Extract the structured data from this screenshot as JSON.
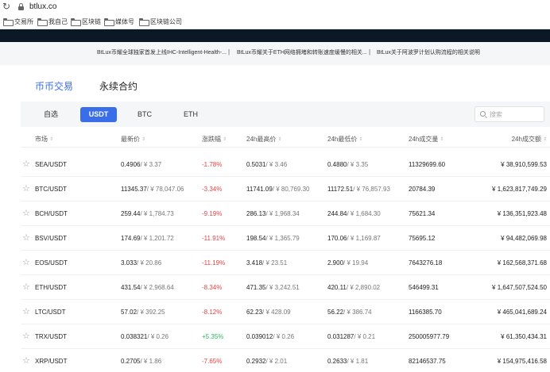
{
  "browser": {
    "url": "btlux.co"
  },
  "bookmarks": [
    {
      "label": "交易所"
    },
    {
      "label": "我自己"
    },
    {
      "label": "区块链"
    },
    {
      "label": "媒体号"
    },
    {
      "label": "区块链公司"
    }
  ],
  "notices": [
    "BtLux币耀全球独家首发上线IHC-Intelligent-Health-...",
    "BtLux币耀关于ETH网络拥堵和转账速度缓慢的相关...",
    "BtLux关于阿波罗计划认购流程的相关说明"
  ],
  "notice_separator": "|",
  "main_tabs": [
    {
      "label": "币币交易",
      "active": true
    },
    {
      "label": "永续合约",
      "active": false
    }
  ],
  "filter_tabs": [
    {
      "label": "自选",
      "active": false
    },
    {
      "label": "USDT",
      "active": true
    },
    {
      "label": "BTC",
      "active": false
    },
    {
      "label": "ETH",
      "active": false
    }
  ],
  "search": {
    "placeholder": "搜索"
  },
  "table": {
    "columns": [
      "市场",
      "最新价",
      "涨跌幅",
      "24h最高价",
      "24h最低价",
      "24h成交量",
      "24h成交额"
    ],
    "rows": [
      {
        "market": "SEA/USDT",
        "last": "0.4906",
        "last_cny": "/ ¥ 3.37",
        "change": "-1.78%",
        "high": "0.5031",
        "high_cny": "/ ¥ 3.46",
        "low": "0.4880",
        "low_cny": "/ ¥ 3.35",
        "volume": "11329699.60",
        "amount": "¥ 38,910,599.53"
      },
      {
        "market": "BTC/USDT",
        "last": "11345.37",
        "last_cny": "/ ¥ 78,047.06",
        "change": "-3.34%",
        "high": "11741.09",
        "high_cny": "/ ¥ 80,769.30",
        "low": "11172.51",
        "low_cny": "/ ¥ 76,857.93",
        "volume": "20784.39",
        "amount": "¥ 1,623,817,749.29"
      },
      {
        "market": "BCH/USDT",
        "last": "259.44",
        "last_cny": "/ ¥ 1,784.73",
        "change": "-9.19%",
        "high": "286.13",
        "high_cny": "/ ¥ 1,968.34",
        "low": "244.84",
        "low_cny": "/ ¥ 1,684.30",
        "volume": "75621.34",
        "amount": "¥ 136,351,923.48"
      },
      {
        "market": "BSV/USDT",
        "last": "174.69",
        "last_cny": "/ ¥ 1,201.72",
        "change": "-11.91%",
        "high": "198.54",
        "high_cny": "/ ¥ 1,365.79",
        "low": "170.06",
        "low_cny": "/ ¥ 1,169.87",
        "volume": "75695.12",
        "amount": "¥ 94,482,069.98"
      },
      {
        "market": "EOS/USDT",
        "last": "3.033",
        "last_cny": "/ ¥ 20.86",
        "change": "-11.19%",
        "high": "3.418",
        "high_cny": "/ ¥ 23.51",
        "low": "2.900",
        "low_cny": "/ ¥ 19.94",
        "volume": "7643276.18",
        "amount": "¥ 162,568,371.68"
      },
      {
        "market": "ETH/USDT",
        "last": "431.54",
        "last_cny": "/ ¥ 2,968.64",
        "change": "-8.34%",
        "high": "471.35",
        "high_cny": "/ ¥ 3,242.51",
        "low": "420.11",
        "low_cny": "/ ¥ 2,890.02",
        "volume": "546499.31",
        "amount": "¥ 1,647,507,524.50"
      },
      {
        "market": "LTC/USDT",
        "last": "57.02",
        "last_cny": "/ ¥ 392.25",
        "change": "-8.12%",
        "high": "62.23",
        "high_cny": "/ ¥ 428.09",
        "low": "56.22",
        "low_cny": "/ ¥ 386.74",
        "volume": "1166385.70",
        "amount": "¥ 465,041,689.24"
      },
      {
        "market": "TRX/USDT",
        "last": "0.038321",
        "last_cny": "/ ¥ 0.26",
        "change": "+5.35%",
        "high": "0.039012",
        "high_cny": "/ ¥ 0.26",
        "low": "0.031287",
        "low_cny": "/ ¥ 0.21",
        "volume": "250005977.79",
        "amount": "¥ 61,350,434.31"
      },
      {
        "market": "XRP/USDT",
        "last": "0.2705",
        "last_cny": "/ ¥ 1.86",
        "change": "-7.65%",
        "high": "0.2932",
        "high_cny": "/ ¥ 2.01",
        "low": "0.2633",
        "low_cny": "/ ¥ 1.81",
        "volume": "82146537.75",
        "amount": "¥ 154,975,416.58"
      }
    ]
  },
  "colors": {
    "accent": "#3a6ee8",
    "down": "#e04545",
    "up": "#2db860",
    "banner": "#0d1826"
  }
}
